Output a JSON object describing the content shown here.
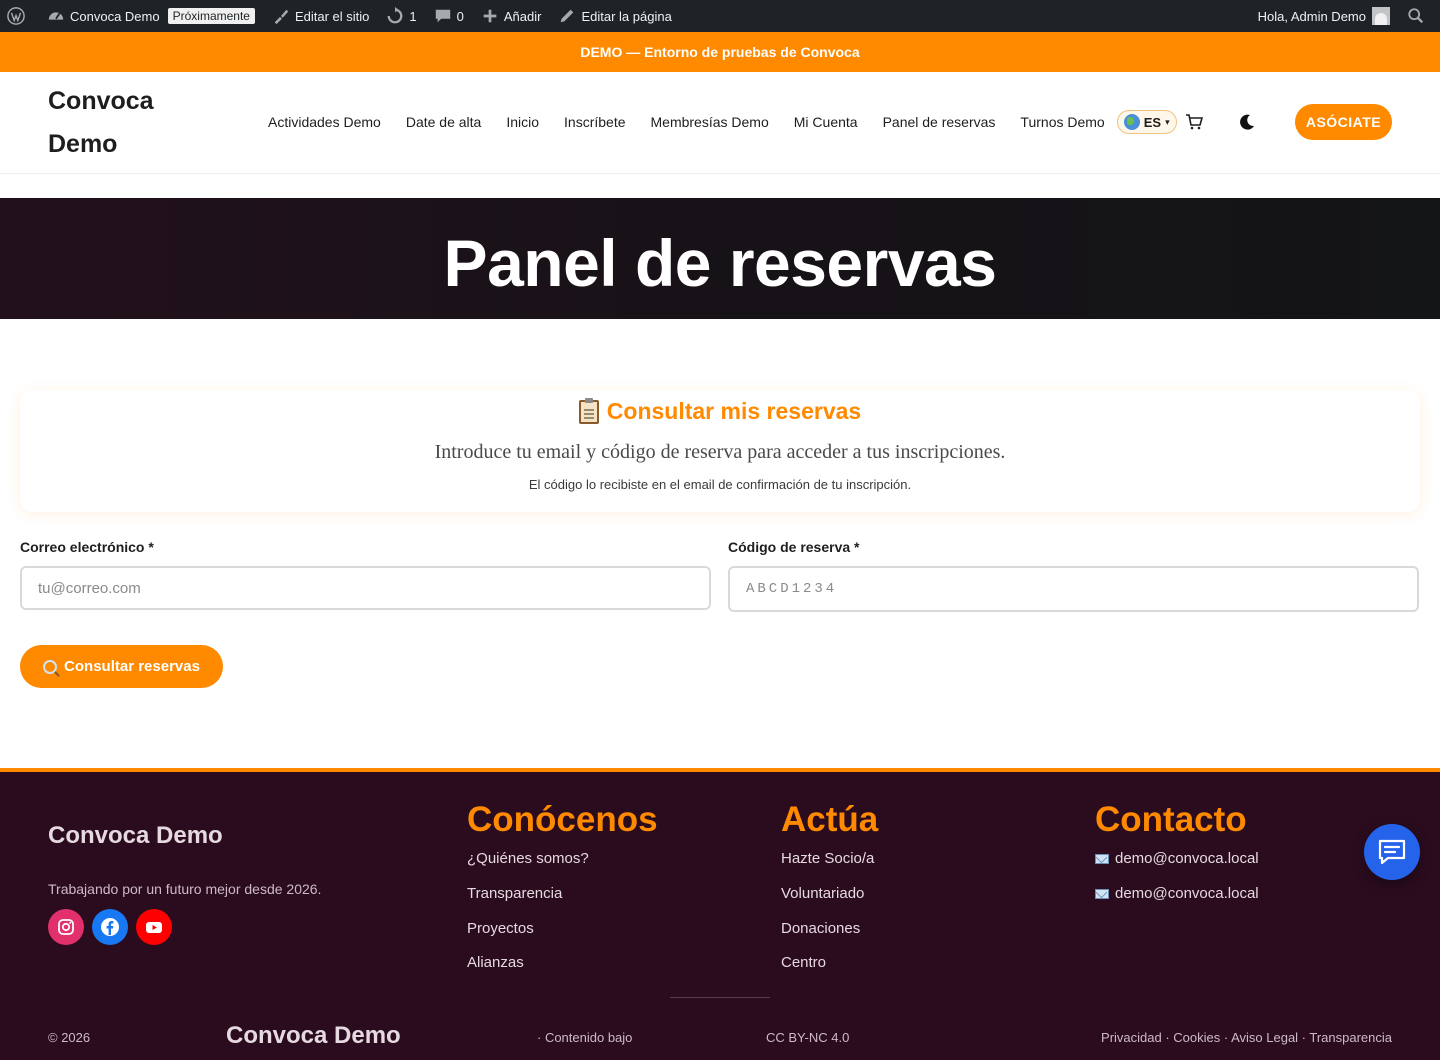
{
  "adminbar": {
    "site_name": "Convoca Demo",
    "soon_badge": "Próximamente",
    "edit_site": "Editar el sitio",
    "updates_count": "1",
    "comments_count": "0",
    "add_new": "Añadir",
    "edit_page": "Editar la página",
    "greeting": "Hola, Admin Demo",
    "icons": [
      "wordpress-icon",
      "dashboard-icon",
      "brush-icon",
      "updates-icon",
      "comments-icon",
      "plus-icon",
      "pencil-icon",
      "search-icon"
    ]
  },
  "demo_banner": "DEMO — Entorno de pruebas de Convoca",
  "header": {
    "site_title": "Convoca Demo",
    "nav": [
      "Actividades Demo",
      "Date de alta",
      "Inicio",
      "Inscríbete",
      "Membresías Demo",
      "Mi Cuenta",
      "Panel de reservas",
      "Turnos Demo"
    ],
    "language": "ES",
    "join_button": "ASÓCIATE"
  },
  "hero": {
    "title": "Panel de reservas"
  },
  "card": {
    "title": "Consultar mis reservas",
    "lead": "Introduce tu email y código de reserva para acceder a tus inscripciones.",
    "note": "El código lo recibiste en el email de confirmación de tu inscripción."
  },
  "form": {
    "email_label": "Correo electrónico *",
    "email_placeholder": "tu@correo.com",
    "code_label": "Código de reserva *",
    "code_placeholder": "ABCD1234",
    "submit_label": "Consultar reservas"
  },
  "footer": {
    "brand": "Convoca Demo",
    "tagline": "Trabajando por un futuro mejor desde 2026.",
    "social": [
      "instagram-icon",
      "facebook-icon",
      "youtube-icon"
    ],
    "columns": [
      {
        "title": "Conócenos",
        "links": [
          "¿Quiénes somos?",
          "Transparencia",
          "Proyectos",
          "Alianzas"
        ]
      },
      {
        "title": "Actúa",
        "links": [
          "Hazte Socio/a",
          "Voluntariado",
          "Donaciones",
          "Centro"
        ]
      },
      {
        "title": "Contacto",
        "links": [
          "demo@convoca.local",
          "demo@convoca.local"
        ]
      }
    ],
    "copyright": "© 2026",
    "bottom_brand": "Convoca Demo",
    "content_note": "· Contenido bajo",
    "license": "CC BY-NC 4.0",
    "legal": "Privacidad · Cookies · Aviso Legal · Transparencia"
  },
  "colors": {
    "accent": "#ff8a00",
    "adminbar": "#1d2327",
    "footer_bg": "#2a0c1e",
    "chat_fab": "#2563eb"
  }
}
